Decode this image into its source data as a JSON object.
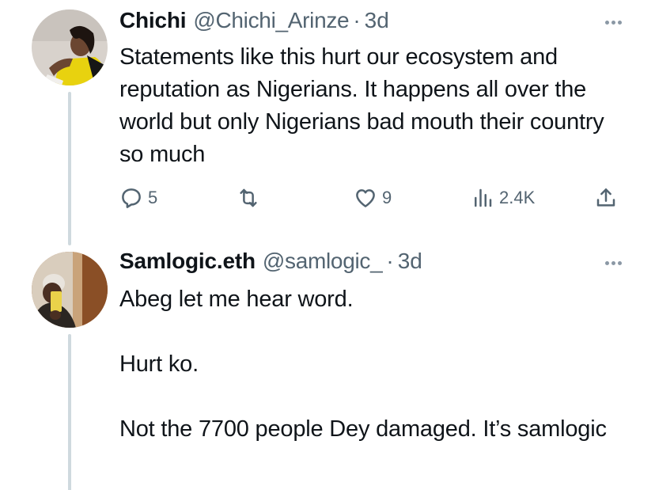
{
  "tweets": [
    {
      "name": "Chichi",
      "handle": "@Chichi_Arinze",
      "separator": "·",
      "time": "3d",
      "text": "Statements like this hurt our ecosystem and reputation as Nigerians. It happens all over the world but only Nigerians bad mouth their country so much",
      "reply_count": "5",
      "retweet_count": "",
      "like_count": "9",
      "view_count": "2.4K"
    },
    {
      "name": "Samlogic.eth",
      "handle": "@samlogic_",
      "separator": "·",
      "time": "3d",
      "paragraphs": [
        "Abeg let me hear word.",
        "Hurt ko.",
        "Not the 7700 people Dey damaged. It’s samlogic"
      ]
    }
  ],
  "icons": {
    "reply": "reply-icon",
    "retweet": "retweet-icon",
    "like": "heart-icon",
    "views": "views-icon",
    "share": "share-icon",
    "more": "more-icon"
  },
  "colors": {
    "text": "#0f1419",
    "secondary": "#536471",
    "thread_line": "#cfd9de",
    "icon": "#536471"
  }
}
